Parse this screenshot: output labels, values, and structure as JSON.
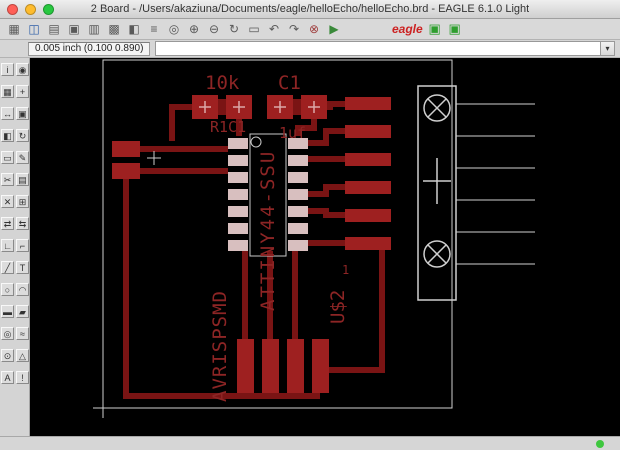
{
  "window": {
    "title": "2 Board - /Users/akaziuna/Documents/eagle/helloEcho/helloEcho.brd - EAGLE 6.1.0 Light",
    "close_color": "#ff5f57",
    "minimize_color": "#febc2e",
    "zoom_color": "#28c840"
  },
  "toolbar": {
    "icons": [
      {
        "name": "open-button",
        "glyph": "▦",
        "color": "#5a5a5a"
      },
      {
        "name": "save-button",
        "glyph": "◫",
        "color": "#2f5fa8"
      },
      {
        "name": "print-button",
        "glyph": "▤",
        "color": "#5a5a5a"
      },
      {
        "name": "cam-processor-button",
        "glyph": "▣",
        "color": "#5a5a5a"
      },
      {
        "name": "switch-schematic-button",
        "glyph": "▥",
        "color": "#5a5a5a"
      },
      {
        "name": "library-button",
        "glyph": "▩",
        "color": "#5a5a5a"
      },
      {
        "name": "sheet-button",
        "glyph": "◧",
        "color": "#5a5a5a"
      },
      {
        "name": "layer-settings-button",
        "glyph": "≡",
        "color": "#5a5a5a"
      },
      {
        "name": "zoom-fit-button",
        "glyph": "◎",
        "color": "#5a5a5a"
      },
      {
        "name": "zoom-in-button",
        "glyph": "⊕",
        "color": "#5a5a5a"
      },
      {
        "name": "zoom-out-button",
        "glyph": "⊖",
        "color": "#5a5a5a"
      },
      {
        "name": "zoom-redraw-button",
        "glyph": "↻",
        "color": "#5a5a5a"
      },
      {
        "name": "zoom-select-button",
        "glyph": "▭",
        "color": "#5a5a5a"
      },
      {
        "name": "undo-button",
        "glyph": "↶",
        "color": "#5a5a5a"
      },
      {
        "name": "redo-button",
        "glyph": "↷",
        "color": "#5a5a5a"
      },
      {
        "name": "stop-button",
        "glyph": "⊗",
        "color": "#a04040"
      },
      {
        "name": "go-button",
        "glyph": "▶",
        "color": "#3a8a3a"
      },
      {
        "name": "eagle-logo",
        "glyph": "eagle",
        "color": "#cc2222"
      },
      {
        "name": "pcb-service-badge",
        "glyph": "▣",
        "color": "#2e9e2e"
      },
      {
        "name": "help-badge",
        "glyph": "▣",
        "color": "#2e9e2e"
      }
    ]
  },
  "coordbar": {
    "coordinates": "0.005 inch (0.100 0.890)",
    "command_value": "",
    "dropdown_glyph": "▾"
  },
  "palette": {
    "tools": [
      {
        "name": "tool-info",
        "glyph": "i"
      },
      {
        "name": "tool-show",
        "glyph": "◉"
      },
      {
        "name": "tool-display",
        "glyph": "▦"
      },
      {
        "name": "tool-mark",
        "glyph": "+"
      },
      {
        "name": "tool-move",
        "glyph": "↔"
      },
      {
        "name": "tool-copy",
        "glyph": "▣"
      },
      {
        "name": "tool-mirror",
        "glyph": "◧"
      },
      {
        "name": "tool-rotate",
        "glyph": "↻"
      },
      {
        "name": "tool-group",
        "glyph": "▭"
      },
      {
        "name": "tool-change",
        "glyph": "✎"
      },
      {
        "name": "tool-cut",
        "glyph": "✂"
      },
      {
        "name": "tool-paste",
        "glyph": "▤"
      },
      {
        "name": "tool-delete",
        "glyph": "✕"
      },
      {
        "name": "tool-add",
        "glyph": "⊞"
      },
      {
        "name": "tool-pinswap",
        "glyph": "⇄"
      },
      {
        "name": "tool-replace",
        "glyph": "⇆"
      },
      {
        "name": "tool-route",
        "glyph": "∟"
      },
      {
        "name": "tool-ripup",
        "glyph": "⌐"
      },
      {
        "name": "tool-wire",
        "glyph": "╱"
      },
      {
        "name": "tool-text",
        "glyph": "T"
      },
      {
        "name": "tool-circle",
        "glyph": "○"
      },
      {
        "name": "tool-arc",
        "glyph": "◠"
      },
      {
        "name": "tool-rect",
        "glyph": "▬"
      },
      {
        "name": "tool-polygon",
        "glyph": "▰"
      },
      {
        "name": "tool-via",
        "glyph": "◎"
      },
      {
        "name": "tool-signal",
        "glyph": "≈"
      },
      {
        "name": "tool-hole",
        "glyph": "⊙"
      },
      {
        "name": "tool-ratsnest",
        "glyph": "△"
      },
      {
        "name": "tool-auto",
        "glyph": "A"
      },
      {
        "name": "tool-errors",
        "glyph": "!"
      }
    ]
  },
  "canvas": {
    "labels": {
      "resistor_value": "10k",
      "capacitor_name": "C1",
      "rc_names": "R1C1",
      "capacitor_value": "1uf",
      "ic_name": "ATTINY44-SSU",
      "programmer_name": "AVRISPSMD",
      "connector_name": "U$2",
      "pin1": "1"
    },
    "colors": {
      "background": "#000000",
      "copper": "#7a1414",
      "pad": "#9e2020",
      "smd_pad": "#d8bfbf",
      "silk": "#8d2525",
      "outline": "#cfcfcf"
    }
  },
  "statusbar": {
    "indicator_color": "#3ec73e"
  }
}
